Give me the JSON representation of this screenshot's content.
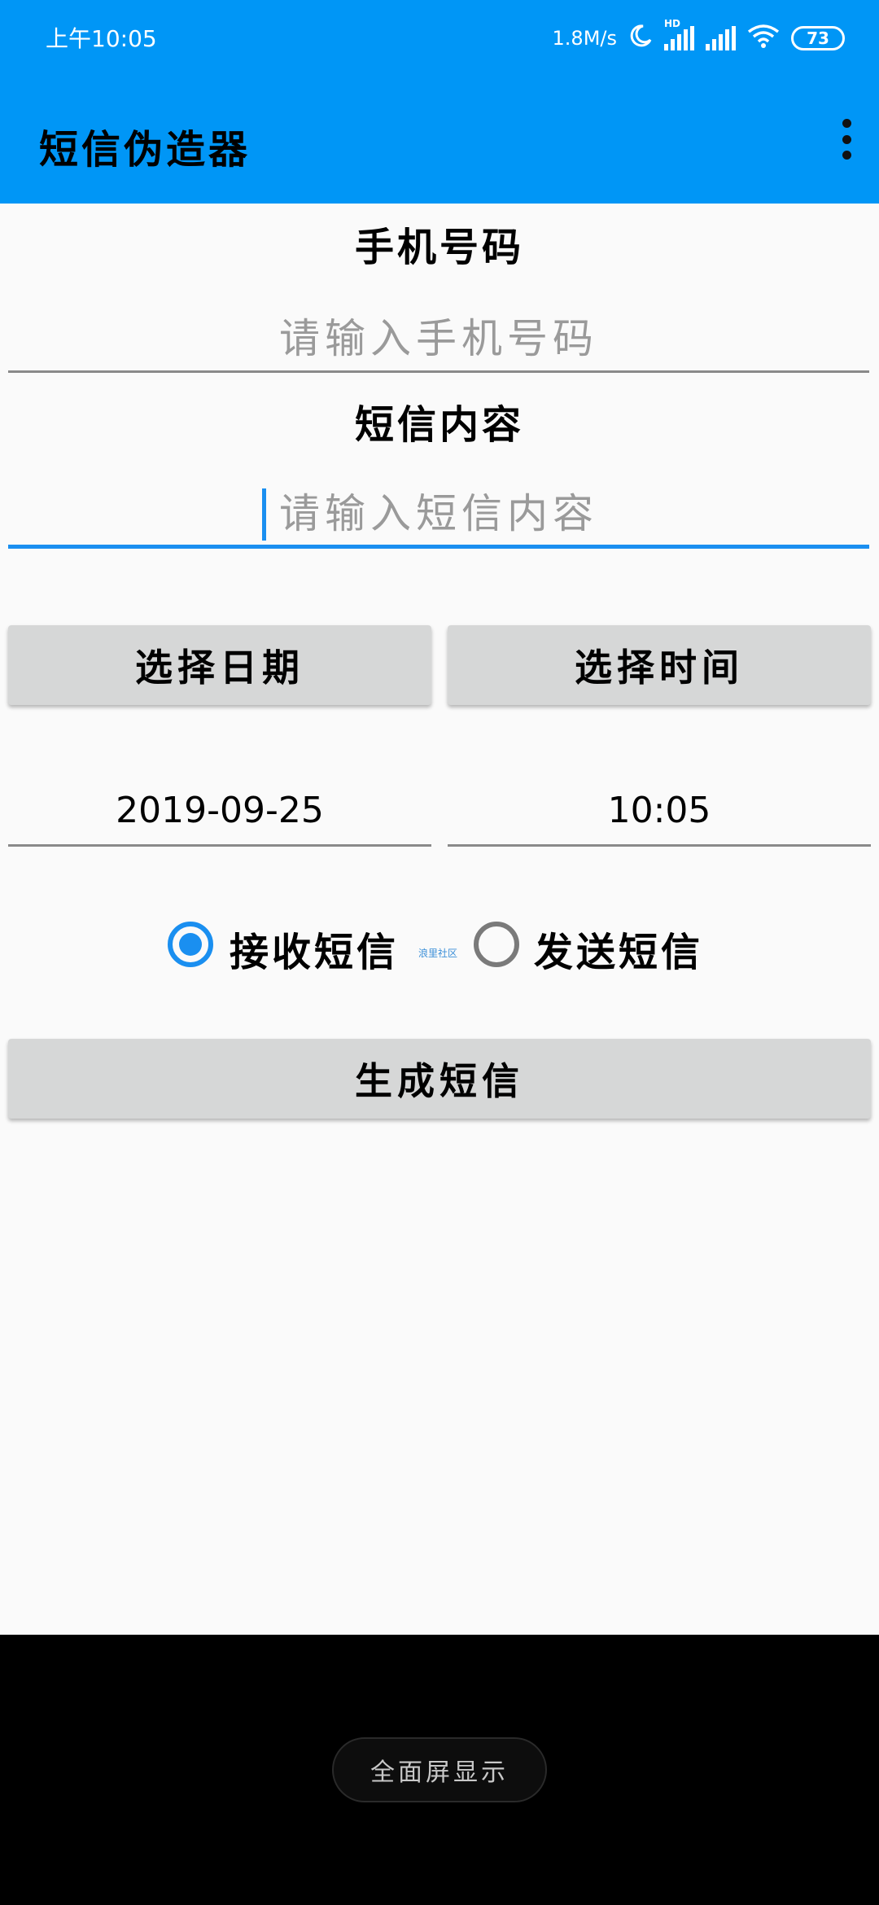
{
  "status_bar": {
    "time": "上午10:05",
    "speed": "1.8M/s",
    "hd": "HD",
    "battery": "73"
  },
  "app_bar": {
    "title": "短信伪造器"
  },
  "form": {
    "phone_label": "手机号码",
    "phone_placeholder": "请输入手机号码",
    "content_label": "短信内容",
    "content_placeholder": "请输入短信内容",
    "select_date_label": "选择日期",
    "select_time_label": "选择时间",
    "date_value": "2019-09-25",
    "time_value": "10:05",
    "radio_receive_label": "接收短信",
    "radio_send_label": "发送短信",
    "watermark": "浪里社区",
    "generate_label": "生成短信"
  },
  "navigation": {
    "fullscreen_label": "全面屏显示"
  },
  "colors": {
    "primary": "#0096f6",
    "accent": "#1a8ff0",
    "button_bg": "#d6d7d7"
  }
}
